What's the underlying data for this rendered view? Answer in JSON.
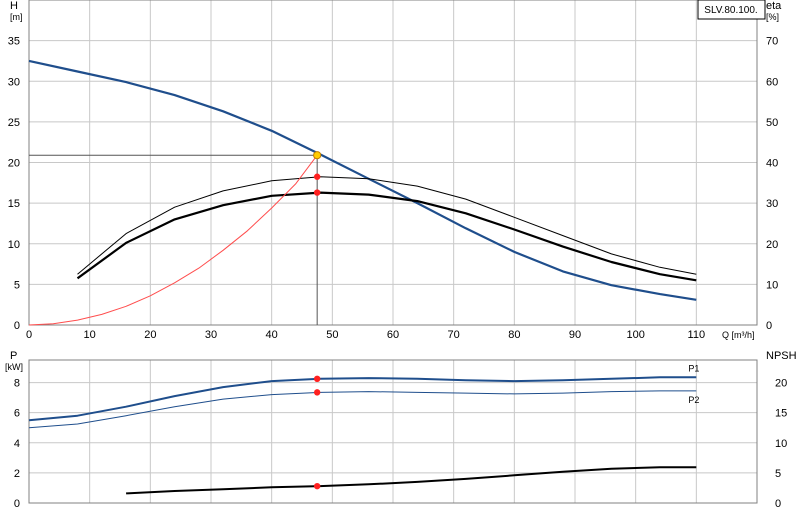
{
  "model_label": "SLV.80.100.",
  "colors": {
    "head_curve": "#1f4e8c",
    "power_curve": "#1f4e8c",
    "efficiency_curve": "#000000",
    "npsh_curve": "#000000",
    "system_curve": "#ff4d4d",
    "duty_marker": "#ff2020",
    "duty_point_fill": "#ffcc00",
    "grid": "#c8c8c8"
  },
  "chart_data": [
    {
      "type": "line",
      "name": "main",
      "xlabel": "Q",
      "xunit": "[m³/h]",
      "y_left_label": "H",
      "y_left_unit": "[m]",
      "y_right_label": "eta",
      "y_right_unit": "[%]",
      "xlim": [
        0,
        120
      ],
      "ylim_left": [
        0,
        40
      ],
      "ylim_right": [
        0,
        80
      ],
      "x_ticks": [
        0,
        10,
        20,
        30,
        40,
        50,
        60,
        70,
        80,
        90,
        100,
        110
      ],
      "y_left_ticks": [
        0,
        5,
        10,
        15,
        20,
        25,
        30,
        35
      ],
      "y_right_ticks": [
        0,
        10,
        20,
        30,
        40,
        50,
        60,
        70
      ],
      "grid": true,
      "series": [
        {
          "id": "head",
          "axis": "left",
          "width": 2.2,
          "x": [
            0,
            8,
            16,
            24,
            32,
            40,
            48,
            56,
            64,
            72,
            80,
            88,
            96,
            104,
            110
          ],
          "y": [
            32.5,
            31.2,
            29.9,
            28.3,
            26.3,
            23.9,
            21.0,
            18.0,
            15.0,
            11.9,
            9.0,
            6.6,
            4.9,
            3.8,
            3.1
          ]
        },
        {
          "id": "eta_a",
          "axis": "right",
          "width": 1,
          "x": [
            8,
            16,
            24,
            32,
            40,
            48,
            56,
            64,
            72,
            80,
            88,
            96,
            104,
            110
          ],
          "y": [
            12.5,
            22.5,
            29.0,
            33.0,
            35.5,
            36.5,
            36.0,
            34.2,
            31.0,
            26.5,
            22.0,
            17.5,
            14.2,
            12.5
          ]
        },
        {
          "id": "eta_b",
          "axis": "right",
          "width": 2.2,
          "x": [
            8,
            16,
            24,
            32,
            40,
            48,
            56,
            64,
            72,
            80,
            88,
            96,
            104,
            110
          ],
          "y": [
            11.5,
            20.2,
            26.0,
            29.5,
            31.8,
            32.6,
            32.1,
            30.5,
            27.5,
            23.5,
            19.3,
            15.5,
            12.5,
            11.0
          ]
        },
        {
          "id": "system",
          "axis": "left",
          "width": 1,
          "thin": true,
          "x": [
            0,
            4,
            8,
            12,
            16,
            20,
            24,
            28,
            32,
            36,
            40,
            44,
            47.5
          ],
          "y": [
            0,
            0.15,
            0.6,
            1.3,
            2.3,
            3.6,
            5.2,
            7.0,
            9.2,
            11.6,
            14.4,
            17.4,
            20.9
          ]
        }
      ],
      "duty_point": {
        "x": 47.5,
        "head": 20.9,
        "eta_a": 36.5,
        "eta_b": 32.6
      }
    },
    {
      "type": "line",
      "name": "power_npsh",
      "y_left_label": "P",
      "y_left_unit": "[kW]",
      "y_right_label": "NPSH",
      "y_right_unit": "",
      "xlim": [
        0,
        120
      ],
      "ylim_left": [
        0,
        9.5
      ],
      "ylim_right": [
        0,
        23.75
      ],
      "y_left_ticks": [
        0,
        2,
        4,
        6,
        8
      ],
      "y_right_ticks": [
        0,
        5,
        10,
        15,
        20
      ],
      "grid": true,
      "series": [
        {
          "id": "P1",
          "name": "P1",
          "axis": "left",
          "width": 2,
          "x": [
            0,
            8,
            16,
            24,
            32,
            40,
            48,
            56,
            64,
            72,
            80,
            88,
            96,
            104,
            110
          ],
          "y": [
            5.5,
            5.8,
            6.4,
            7.1,
            7.7,
            8.1,
            8.25,
            8.3,
            8.25,
            8.15,
            8.1,
            8.15,
            8.25,
            8.35,
            8.35
          ]
        },
        {
          "id": "P2",
          "name": "P2",
          "axis": "left",
          "width": 1,
          "x": [
            0,
            8,
            16,
            24,
            32,
            40,
            48,
            56,
            64,
            72,
            80,
            88,
            96,
            104,
            110
          ],
          "y": [
            5.0,
            5.25,
            5.8,
            6.4,
            6.9,
            7.2,
            7.35,
            7.4,
            7.35,
            7.3,
            7.25,
            7.3,
            7.4,
            7.45,
            7.45
          ]
        },
        {
          "id": "NPSH",
          "axis": "right",
          "width": 2,
          "x": [
            16,
            24,
            32,
            40,
            48,
            56,
            64,
            72,
            80,
            88,
            96,
            104,
            110
          ],
          "y": [
            1.6,
            2.0,
            2.3,
            2.6,
            2.8,
            3.1,
            3.5,
            4.0,
            4.6,
            5.2,
            5.7,
            5.95,
            5.95
          ]
        }
      ],
      "duty_point": {
        "x": 47.5,
        "P1": 8.25,
        "P2": 7.35,
        "NPSH": 2.8
      }
    }
  ]
}
